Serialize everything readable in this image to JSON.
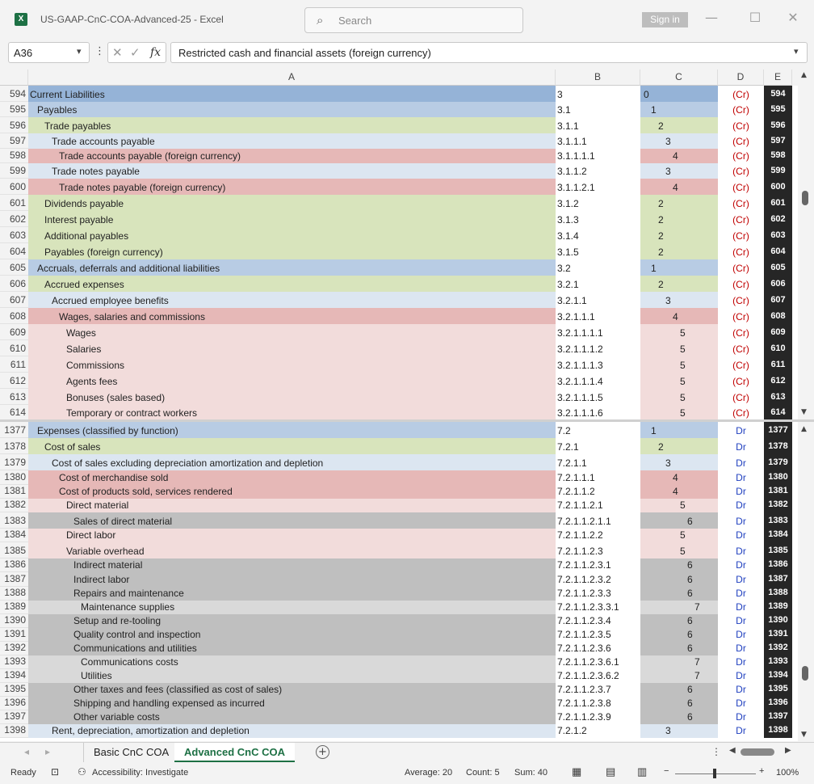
{
  "window": {
    "app_icon": "X",
    "title": "US-GAAP-CnC-COA-Advanced-25  -  Excel",
    "search_placeholder": "Search",
    "signin_label": "Sign in",
    "minimize": "—",
    "maximize": "☐",
    "close": "✕"
  },
  "formula_bar": {
    "name_box": "A36",
    "fx": "fx",
    "formula": "Restricted cash and financial assets (foreign currency)"
  },
  "columns": [
    "A",
    "B",
    "C",
    "D",
    "E"
  ],
  "pane_top": [
    {
      "n": "594",
      "a": "Current Liabilities",
      "b": "3",
      "c": "0",
      "d": "(Cr)",
      "e": "594",
      "lvl": 0,
      "col": "#95b3d7"
    },
    {
      "n": "595",
      "a": "Payables",
      "b": "3.1",
      "c": "1",
      "d": "(Cr)",
      "e": "595",
      "lvl": 1,
      "col": "#b8cce4"
    },
    {
      "n": "596",
      "a": "Trade payables",
      "b": "3.1.1",
      "c": "2",
      "d": "(Cr)",
      "e": "596",
      "lvl": 2,
      "col": "#d8e4bc"
    },
    {
      "n": "597",
      "a": "Trade accounts payable",
      "b": "3.1.1.1",
      "c": "3",
      "d": "(Cr)",
      "e": "597",
      "lvl": 3,
      "col": "#dce6f1"
    },
    {
      "n": "598",
      "a": "Trade accounts payable (foreign currency)",
      "b": "3.1.1.1.1",
      "c": "4",
      "d": "(Cr)",
      "e": "598",
      "lvl": 4,
      "col": "#e6b8b7"
    },
    {
      "n": "599",
      "a": "Trade notes payable",
      "b": "3.1.1.2",
      "c": "3",
      "d": "(Cr)",
      "e": "599",
      "lvl": 3,
      "col": "#dce6f1"
    },
    {
      "n": "600",
      "a": "Trade notes payable (foreign currency)",
      "b": "3.1.1.2.1",
      "c": "4",
      "d": "(Cr)",
      "e": "600",
      "lvl": 4,
      "col": "#e6b8b7"
    },
    {
      "n": "601",
      "a": "Dividends payable",
      "b": "3.1.2",
      "c": "2",
      "d": "(Cr)",
      "e": "601",
      "lvl": 2,
      "col": "#d8e4bc"
    },
    {
      "n": "602",
      "a": "Interest payable",
      "b": "3.1.3",
      "c": "2",
      "d": "(Cr)",
      "e": "602",
      "lvl": 2,
      "col": "#d8e4bc"
    },
    {
      "n": "603",
      "a": "Additional payables",
      "b": "3.1.4",
      "c": "2",
      "d": "(Cr)",
      "e": "603",
      "lvl": 2,
      "col": "#d8e4bc"
    },
    {
      "n": "604",
      "a": "Payables (foreign currency)",
      "b": "3.1.5",
      "c": "2",
      "d": "(Cr)",
      "e": "604",
      "lvl": 2,
      "col": "#d8e4bc"
    },
    {
      "n": "605",
      "a": "Accruals, deferrals and additional liabilities",
      "b": "3.2",
      "c": "1",
      "d": "(Cr)",
      "e": "605",
      "lvl": 1,
      "col": "#b8cce4"
    },
    {
      "n": "606",
      "a": "Accrued expenses",
      "b": "3.2.1",
      "c": "2",
      "d": "(Cr)",
      "e": "606",
      "lvl": 2,
      "col": "#d8e4bc"
    },
    {
      "n": "607",
      "a": "Accrued employee benefits",
      "b": "3.2.1.1",
      "c": "3",
      "d": "(Cr)",
      "e": "607",
      "lvl": 3,
      "col": "#dce6f1"
    },
    {
      "n": "608",
      "a": "Wages, salaries and commissions",
      "b": "3.2.1.1.1",
      "c": "4",
      "d": "(Cr)",
      "e": "608",
      "lvl": 4,
      "col": "#e6b8b7"
    },
    {
      "n": "609",
      "a": "Wages",
      "b": "3.2.1.1.1.1",
      "c": "5",
      "d": "(Cr)",
      "e": "609",
      "lvl": 5,
      "col": "#f2dcdb"
    },
    {
      "n": "610",
      "a": "Salaries",
      "b": "3.2.1.1.1.2",
      "c": "5",
      "d": "(Cr)",
      "e": "610",
      "lvl": 5,
      "col": "#f2dcdb"
    },
    {
      "n": "611",
      "a": "Commissions",
      "b": "3.2.1.1.1.3",
      "c": "5",
      "d": "(Cr)",
      "e": "611",
      "lvl": 5,
      "col": "#f2dcdb"
    },
    {
      "n": "612",
      "a": "Agents fees",
      "b": "3.2.1.1.1.4",
      "c": "5",
      "d": "(Cr)",
      "e": "612",
      "lvl": 5,
      "col": "#f2dcdb"
    },
    {
      "n": "613",
      "a": "Bonuses (sales based)",
      "b": "3.2.1.1.1.5",
      "c": "5",
      "d": "(Cr)",
      "e": "613",
      "lvl": 5,
      "col": "#f2dcdb"
    },
    {
      "n": "614",
      "a": "Temporary or contract workers",
      "b": "3.2.1.1.1.6",
      "c": "5",
      "d": "(Cr)",
      "e": "614",
      "lvl": 5,
      "col": "#f2dcdb"
    }
  ],
  "pane_bottom": [
    {
      "n": "1377",
      "a": "Expenses (classified by function)",
      "b": "7.2",
      "c": "1",
      "d": "Dr",
      "e": "1377",
      "lvl": 1,
      "col": "#b8cce4"
    },
    {
      "n": "1378",
      "a": "Cost of sales",
      "b": "7.2.1",
      "c": "2",
      "d": "Dr",
      "e": "1378",
      "lvl": 2,
      "col": "#d8e4bc"
    },
    {
      "n": "1379",
      "a": "Cost of sales excluding depreciation amortization and depletion",
      "b": "7.2.1.1",
      "c": "3",
      "d": "Dr",
      "e": "1379",
      "lvl": 3,
      "col": "#dce6f1"
    },
    {
      "n": "1380",
      "a": "Cost of merchandise sold",
      "b": "7.2.1.1.1",
      "c": "4",
      "d": "Dr",
      "e": "1380",
      "lvl": 4,
      "col": "#e6b8b7"
    },
    {
      "n": "1381",
      "a": "Cost of products sold, services rendered",
      "b": "7.2.1.1.2",
      "c": "4",
      "d": "Dr",
      "e": "1381",
      "lvl": 4,
      "col": "#e6b8b7"
    },
    {
      "n": "1382",
      "a": "Direct material",
      "b": "7.2.1.1.2.1",
      "c": "5",
      "d": "Dr",
      "e": "1382",
      "lvl": 5,
      "col": "#f2dcdb"
    },
    {
      "n": "1383",
      "a": "Sales of direct material",
      "b": "7.2.1.1.2.1.1",
      "c": "6",
      "d": "Dr",
      "e": "1383",
      "lvl": 6,
      "col": "#bfbfbf"
    },
    {
      "n": "1384",
      "a": "Direct labor",
      "b": "7.2.1.1.2.2",
      "c": "5",
      "d": "Dr",
      "e": "1384",
      "lvl": 5,
      "col": "#f2dcdb"
    },
    {
      "n": "1385",
      "a": "Variable overhead",
      "b": "7.2.1.1.2.3",
      "c": "5",
      "d": "Dr",
      "e": "1385",
      "lvl": 5,
      "col": "#f2dcdb"
    },
    {
      "n": "1386",
      "a": "Indirect material",
      "b": "7.2.1.1.2.3.1",
      "c": "6",
      "d": "Dr",
      "e": "1386",
      "lvl": 6,
      "col": "#bfbfbf"
    },
    {
      "n": "1387",
      "a": "Indirect labor",
      "b": "7.2.1.1.2.3.2",
      "c": "6",
      "d": "Dr",
      "e": "1387",
      "lvl": 6,
      "col": "#bfbfbf"
    },
    {
      "n": "1388",
      "a": "Repairs and maintenance",
      "b": "7.2.1.1.2.3.3",
      "c": "6",
      "d": "Dr",
      "e": "1388",
      "lvl": 6,
      "col": "#bfbfbf"
    },
    {
      "n": "1389",
      "a": "Maintenance supplies",
      "b": "7.2.1.1.2.3.3.1",
      "c": "7",
      "d": "Dr",
      "e": "1389",
      "lvl": 7,
      "col": "#d9d9d9"
    },
    {
      "n": "1390",
      "a": "Setup and re-tooling",
      "b": "7.2.1.1.2.3.4",
      "c": "6",
      "d": "Dr",
      "e": "1390",
      "lvl": 6,
      "col": "#bfbfbf"
    },
    {
      "n": "1391",
      "a": "Quality control and inspection",
      "b": "7.2.1.1.2.3.5",
      "c": "6",
      "d": "Dr",
      "e": "1391",
      "lvl": 6,
      "col": "#bfbfbf"
    },
    {
      "n": "1392",
      "a": "Communications and utilities",
      "b": "7.2.1.1.2.3.6",
      "c": "6",
      "d": "Dr",
      "e": "1392",
      "lvl": 6,
      "col": "#bfbfbf"
    },
    {
      "n": "1393",
      "a": "Communications costs",
      "b": "7.2.1.1.2.3.6.1",
      "c": "7",
      "d": "Dr",
      "e": "1393",
      "lvl": 7,
      "col": "#d9d9d9"
    },
    {
      "n": "1394",
      "a": "Utilities",
      "b": "7.2.1.1.2.3.6.2",
      "c": "7",
      "d": "Dr",
      "e": "1394",
      "lvl": 7,
      "col": "#d9d9d9"
    },
    {
      "n": "1395",
      "a": "Other taxes and fees (classified as cost of sales)",
      "b": "7.2.1.1.2.3.7",
      "c": "6",
      "d": "Dr",
      "e": "1395",
      "lvl": 6,
      "col": "#bfbfbf"
    },
    {
      "n": "1396",
      "a": "Shipping and handling expensed as incurred",
      "b": "7.2.1.1.2.3.8",
      "c": "6",
      "d": "Dr",
      "e": "1396",
      "lvl": 6,
      "col": "#bfbfbf"
    },
    {
      "n": "1397",
      "a": "Other variable costs",
      "b": "7.2.1.1.2.3.9",
      "c": "6",
      "d": "Dr",
      "e": "1397",
      "lvl": 6,
      "col": "#bfbfbf"
    },
    {
      "n": "1398",
      "a": "Rent, depreciation, amortization and depletion",
      "b": "7.2.1.2",
      "c": "3",
      "d": "Dr",
      "e": "1398",
      "lvl": 3,
      "col": "#dce6f1"
    }
  ],
  "tabs": {
    "basic": "Basic CnC COA",
    "advanced": "Advanced CnC COA",
    "add": "+"
  },
  "status": {
    "ready": "Ready",
    "accessibility": "Accessibility: Investigate",
    "average": "Average: 20",
    "count": "Count: 5",
    "sum": "Sum: 40",
    "zoom": "100%"
  }
}
